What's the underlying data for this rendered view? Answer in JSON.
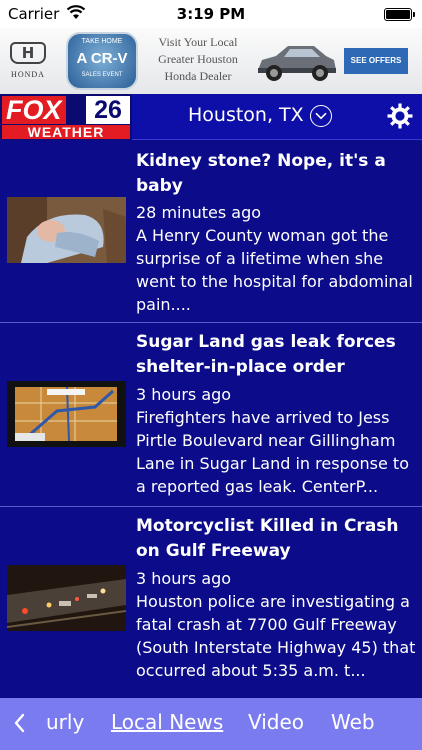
{
  "status_bar": {
    "carrier": "Carrier",
    "time": "3:19 PM"
  },
  "ad": {
    "brand": "HONDA",
    "badge_line1": "TAKE HOME",
    "badge_line2": "A CR-V",
    "badge_line3": "SALES EVENT",
    "copy": "Visit Your Local Greater Houston Honda Dealer",
    "cta": "SEE OFFERS"
  },
  "header": {
    "logo_fox": "FOX",
    "logo_number": "26",
    "logo_weather": "WEATHER",
    "location": "Houston, TX"
  },
  "articles": [
    {
      "title": "Kidney stone? Nope, it's a baby",
      "time": "28 minutes ago",
      "summary": "A Henry County woman got the surprise of a lifetime when she went to the hospital for abdominal pain...."
    },
    {
      "title": "Sugar Land gas leak forces shelter-in-place order",
      "time": "3 hours ago",
      "summary": "Firefighters have arrived to Jess Pirtle Boulevard near Gillingham Lane in Sugar Land in response to a reported gas leak. CenterP..."
    },
    {
      "title": "Motorcyclist Killed in Crash on Gulf Freeway",
      "time": "3 hours ago",
      "summary": "Houston police are investigating a fatal crash at 7700 Gulf Freeway (South Interstate Highway 45) that occurred about 5:35 a.m. t..."
    }
  ],
  "tabs": {
    "items": [
      {
        "label": "urly",
        "active": false
      },
      {
        "label": "Local News",
        "active": true
      },
      {
        "label": "Video",
        "active": false
      },
      {
        "label": "Web",
        "active": false
      }
    ]
  },
  "colors": {
    "background": "#0c0c8a",
    "header": "#0e0ea8",
    "tabbar": "#7b7bf0",
    "fox_red": "#e31b23"
  }
}
